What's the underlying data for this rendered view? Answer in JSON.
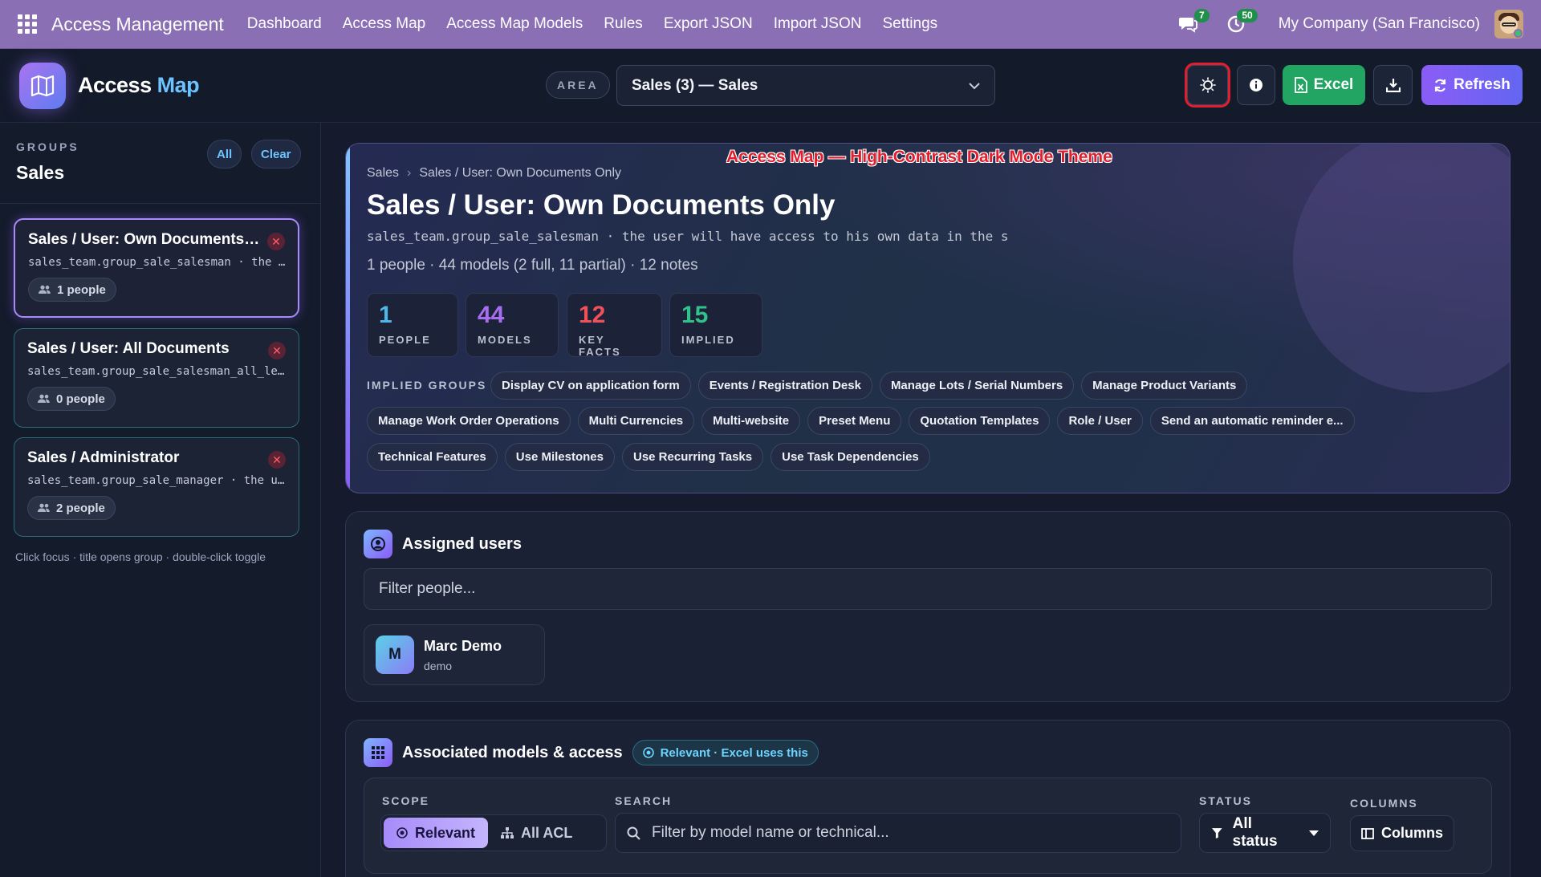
{
  "navbar": {
    "brand": "Access Management",
    "menu": [
      "Dashboard",
      "Access Map",
      "Access Map Models",
      "Rules",
      "Export JSON",
      "Import JSON",
      "Settings"
    ],
    "messages_badge": "7",
    "activity_badge": "50",
    "company": "My Company (San Francisco)"
  },
  "header": {
    "title_part1": "Access",
    "title_part2": "Map",
    "area_label": "AREA",
    "area_value": "Sales (3) — Sales",
    "excel_label": "Excel",
    "refresh_label": "Refresh"
  },
  "sidebar": {
    "label": "GROUPS",
    "title": "Sales",
    "all_label": "All",
    "clear_label": "Clear",
    "groups": [
      {
        "title": "Sales / User: Own Documents Only",
        "sub": "sales_team.group_sale_salesman · the user will have access to his own data",
        "people": "1 people"
      },
      {
        "title": "Sales / User: All Documents",
        "sub": "sales_team.group_sale_salesman_all_leads",
        "people": "0 people"
      },
      {
        "title": "Sales / Administrator",
        "sub": "sales_team.group_sale_manager · the user will have access",
        "people": "2 people"
      }
    ],
    "hint": "Click focus · title opens group · double-click toggle"
  },
  "hero": {
    "watermark": "Access Map — High-Contrast Dark Mode Theme",
    "crumb_root": "Sales",
    "crumb_leaf": "Sales / User: Own Documents Only",
    "title": "Sales / User: Own Documents Only",
    "tech": "sales_team.group_sale_salesman · the user will have access to his own data in the s",
    "stats": "1 people · 44 models (2 full, 11 partial) · 12 notes",
    "kpis": [
      {
        "value": "1",
        "label": "PEOPLE",
        "color": "#4fb7e8"
      },
      {
        "value": "44",
        "label": "MODELS",
        "color": "#a76ff0"
      },
      {
        "value": "12",
        "label": "KEY FACTS",
        "color": "#f0505a"
      },
      {
        "value": "15",
        "label": "IMPLIED",
        "color": "#2fc28a"
      }
    ],
    "implied_label": "IMPLIED GROUPS",
    "implied_row1": [
      "Display CV on application form",
      "Events / Registration Desk",
      "Manage Lots / Serial Numbers",
      "Manage Product Variants"
    ],
    "implied_row2": [
      "Manage Work Order Operations",
      "Multi Currencies",
      "Multi-website",
      "Preset Menu",
      "Quotation Templates",
      "Role / User",
      "Send an automatic reminder e..."
    ],
    "implied_row3": [
      "Technical Features",
      "Use Milestones",
      "Use Recurring Tasks",
      "Use Task Dependencies"
    ]
  },
  "users_panel": {
    "title": "Assigned users",
    "filter_placeholder": "Filter people...",
    "users": [
      {
        "initial": "M",
        "name": "Marc Demo",
        "login": "demo"
      }
    ]
  },
  "models_panel": {
    "title": "Associated models & access",
    "badge": "Relevant · Excel uses this",
    "scope_label": "SCOPE",
    "scope_relevant": "Relevant",
    "scope_all": "All ACL",
    "search_label": "SEARCH",
    "search_placeholder": "Filter by model name or technical...",
    "status_label": "STATUS",
    "status_value": "All status",
    "columns_label": "COLUMNS",
    "columns_button": "Columns"
  }
}
